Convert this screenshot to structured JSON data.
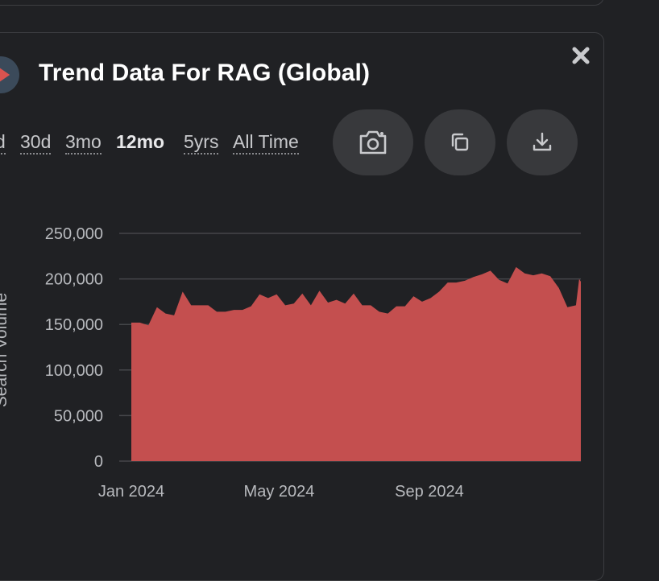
{
  "title": "Trend Data For RAG (Global)",
  "ranges": [
    "d",
    "30d",
    "3mo",
    "12mo",
    "5yrs",
    "All Time"
  ],
  "active_range": "12mo",
  "icons": {
    "close": "close-icon",
    "camera": "camera-icon",
    "copy": "copy-icon",
    "download": "download-icon",
    "logo": "logo-icon"
  },
  "colors": {
    "background": "#202124",
    "area": "#c44f4f",
    "grid": "#45464a",
    "text": "#b8babe"
  },
  "chart_data": {
    "type": "area",
    "ylabel": "Search Volume",
    "ylim": [
      0,
      250000
    ],
    "yticks": [
      "0",
      "50,000",
      "100,000",
      "150,000",
      "200,000",
      "250,000"
    ],
    "xticks": [
      "Jan 2024",
      "May 2024",
      "Sep 2024"
    ],
    "grid": true,
    "x": [
      "2024-01-01",
      "2024-01-08",
      "2024-01-15",
      "2024-01-22",
      "2024-01-29",
      "2024-02-05",
      "2024-02-12",
      "2024-02-19",
      "2024-02-26",
      "2024-03-04",
      "2024-03-11",
      "2024-03-18",
      "2024-03-25",
      "2024-04-01",
      "2024-04-08",
      "2024-04-15",
      "2024-04-22",
      "2024-04-29",
      "2024-05-06",
      "2024-05-13",
      "2024-05-20",
      "2024-05-27",
      "2024-06-03",
      "2024-06-10",
      "2024-06-17",
      "2024-06-24",
      "2024-07-01",
      "2024-07-08",
      "2024-07-15",
      "2024-07-22",
      "2024-07-29",
      "2024-08-05",
      "2024-08-12",
      "2024-08-19",
      "2024-08-26",
      "2024-09-02",
      "2024-09-09",
      "2024-09-16",
      "2024-09-23",
      "2024-09-30",
      "2024-10-07",
      "2024-10-14",
      "2024-10-21",
      "2024-10-28",
      "2024-11-04",
      "2024-11-11",
      "2024-11-18",
      "2024-11-25",
      "2024-12-02",
      "2024-12-09",
      "2024-12-16",
      "2024-12-23",
      "2024-12-30"
    ],
    "series": [
      {
        "values": [
          152000,
          152000,
          149000,
          169000,
          162000,
          160000,
          186000,
          171000,
          171000,
          171000,
          164000,
          164000,
          166000,
          166000,
          170000,
          183000,
          179000,
          183000,
          171000,
          173000,
          184000,
          171000,
          187000,
          174000,
          177000,
          173000,
          184000,
          171000,
          171000,
          164000,
          162000,
          170000,
          170000,
          181000,
          175000,
          179000,
          186000,
          196000,
          196000,
          198000,
          202000,
          205000,
          209000,
          199000,
          195000,
          213000,
          206000,
          204000,
          206000,
          203000,
          190000,
          169000,
          171000,
          200000,
          197000
        ]
      }
    ]
  }
}
